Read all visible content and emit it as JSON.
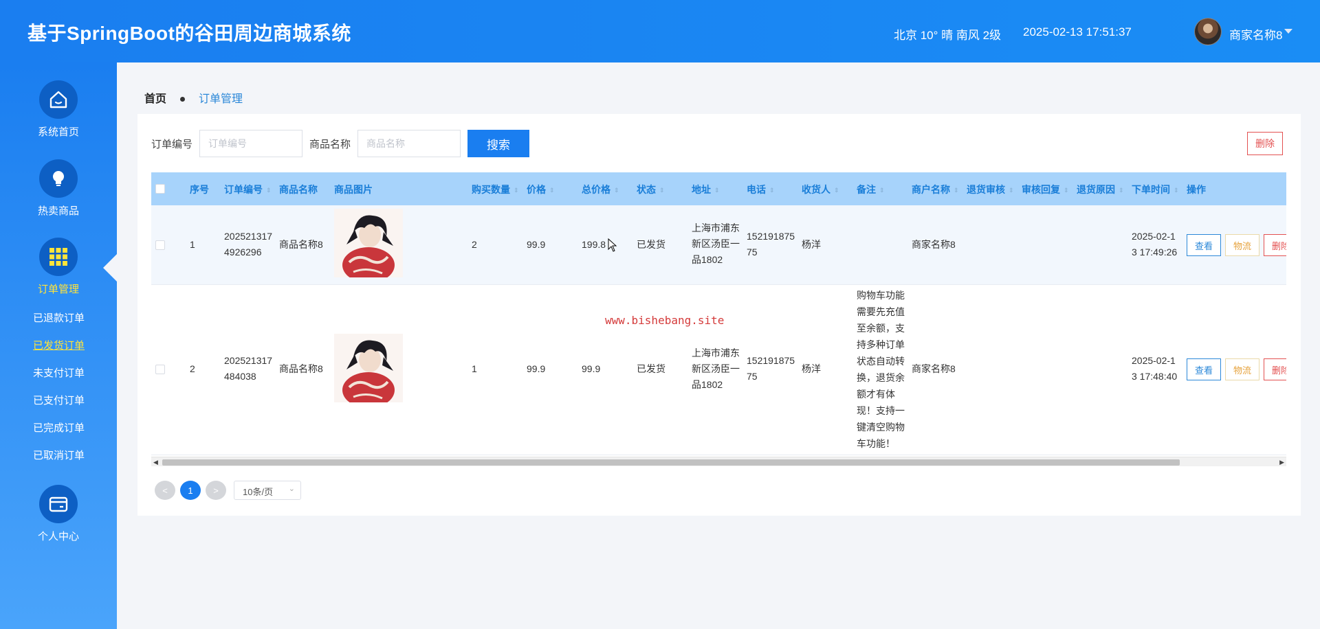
{
  "header": {
    "title": "基于SpringBoot的谷田周边商城系统",
    "weather": "北京  10°  晴  南风  2级",
    "datetime": "2025-02-13 17:51:37",
    "user_name": "商家名称8"
  },
  "sidebar": {
    "items": [
      {
        "label": "系统首页",
        "icon": "home-icon"
      },
      {
        "label": "热卖商品",
        "icon": "lightbulb-icon"
      },
      {
        "label": "订单管理",
        "icon": "grid-icon"
      },
      {
        "label": "个人中心",
        "icon": "wallet-icon"
      }
    ],
    "subitems": [
      "已退款订单",
      "已发货订单",
      "未支付订单",
      "已支付订单",
      "已完成订单",
      "已取消订单"
    ],
    "active_subitem": "已发货订单"
  },
  "breadcrumb": {
    "home": "首页",
    "current": "订单管理"
  },
  "search": {
    "order_no_label": "订单编号",
    "order_no_placeholder": "订单编号",
    "product_label": "商品名称",
    "product_placeholder": "商品名称",
    "search_button": "搜索",
    "delete_button": "删除"
  },
  "table": {
    "headers": [
      "序号",
      "订单编号",
      "商品名称",
      "商品图片",
      "购买数量",
      "价格",
      "总价格",
      "状态",
      "地址",
      "电话",
      "收货人",
      "备注",
      "商户名称",
      "退货审核",
      "审核回复",
      "退货原因",
      "下单时间",
      "操作"
    ],
    "rows": [
      {
        "index": "1",
        "order_no": [
          "202521317",
          "4926296"
        ],
        "product": "商品名称8",
        "quantity": "2",
        "price": "99.9",
        "total": "199.8",
        "status": "已发货",
        "address": [
          "上海市浦东",
          "新区汤臣一",
          "品1802"
        ],
        "phone": [
          "152191875",
          "75"
        ],
        "receiver": "杨洋",
        "remark": [],
        "merchant": "商家名称8",
        "order_time": [
          "2025-02-1",
          "3 17:49:26"
        ]
      },
      {
        "index": "2",
        "order_no": [
          "202521317",
          "484038"
        ],
        "product": "商品名称8",
        "quantity": "1",
        "price": "99.9",
        "total": "99.9",
        "status": "已发货",
        "address": [
          "上海市浦东",
          "新区汤臣一",
          "品1802"
        ],
        "phone": [
          "152191875",
          "75"
        ],
        "receiver": "杨洋",
        "remark": [
          "购物车功能",
          "需要先充值",
          "至余额，支",
          "持多种订单",
          "状态自动转",
          "换，退货余",
          "额才有体",
          "现！支持一",
          "键清空购物",
          "车功能！"
        ],
        "merchant": "商家名称8",
        "order_time": [
          "2025-02-1",
          "3 17:48:40"
        ]
      }
    ],
    "actions": {
      "view": "查看",
      "logistics": "物流",
      "delete": "删除"
    }
  },
  "pagination": {
    "prev": "<",
    "current": "1",
    "next": ">",
    "page_size": "10条/页"
  },
  "watermark": "www.bishebang.site",
  "colors": {
    "primary": "#1a7ef0",
    "active_menu": "#ffe43a",
    "header_row": "#a7d3fb",
    "danger": "#e35050",
    "warning": "#e6a23c"
  }
}
